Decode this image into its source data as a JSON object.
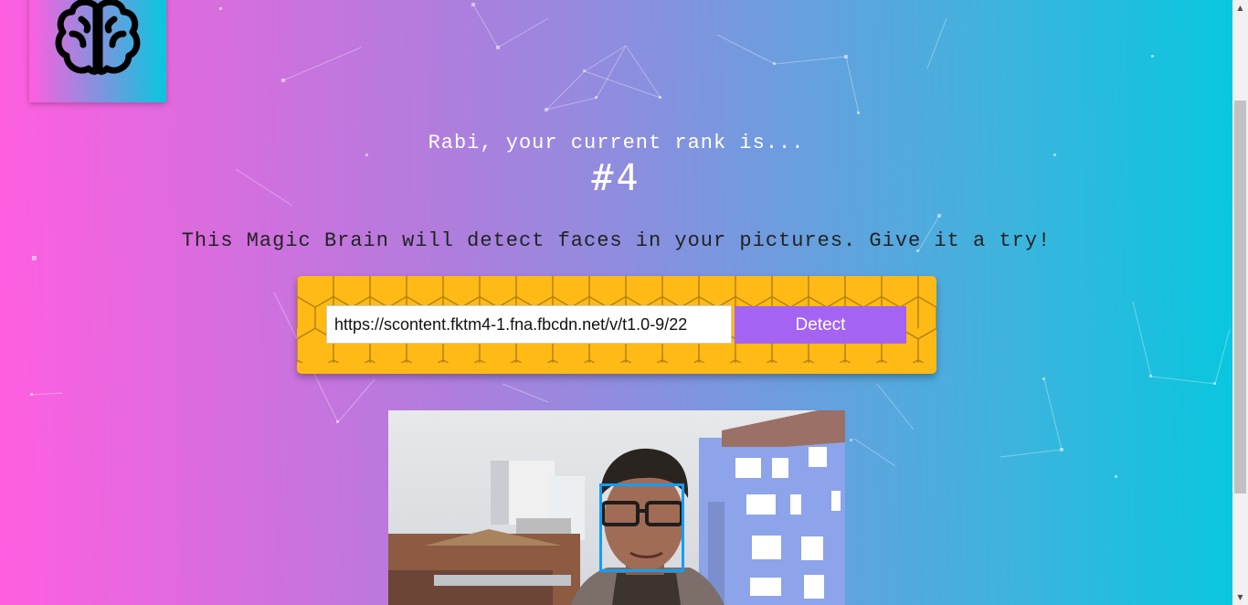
{
  "app": {
    "logo_icon": "brain-icon",
    "rank_message": "Rabi, your current rank is...",
    "rank_value": "#4",
    "tagline": "This Magic Brain will detect faces in your pictures. Give it a try!"
  },
  "form": {
    "url_value": "https://scontent.fktm4-1.fna.fbcdn.net/v/t1.0-9/22",
    "detect_label": "Detect"
  },
  "image": {
    "faces_detected": 1,
    "box_color": "#149df2"
  },
  "colors": {
    "gradient_start": "#ff5edf",
    "gradient_end": "#04c8de",
    "panel_bg": "#ffba15",
    "button_bg": "#a463f2"
  },
  "scrollbar": {
    "up_icon": "scroll-up-arrow-icon",
    "down_icon": "scroll-down-arrow-icon"
  }
}
